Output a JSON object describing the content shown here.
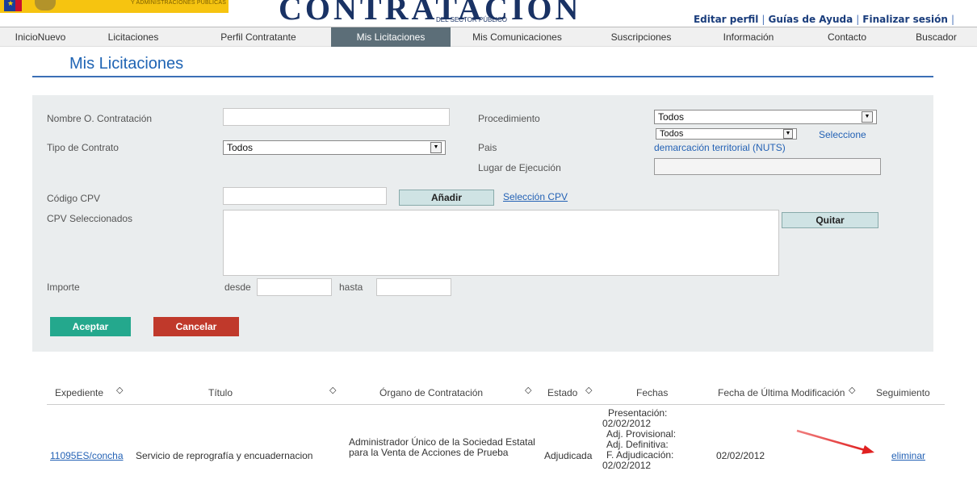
{
  "header": {
    "ministry_text": "Y ADMINISTRACIONES PÚBLICAS",
    "logo_text": "CONTRATACIÓN",
    "logo_subtext": "DEL SECTOR PÚBLICO",
    "user_links": [
      "Editar perfil",
      "Guías de Ayuda",
      "Finalizar sesión"
    ]
  },
  "nav": {
    "items": [
      "InicioNuevo",
      "Licitaciones",
      "Perfil Contratante",
      "Mis Licitaciones",
      "Mis Comunicaciones",
      "Suscripciones",
      "Información",
      "Contacto",
      "Buscador"
    ],
    "active": "Mis Licitaciones"
  },
  "page": {
    "title": "Mis Licitaciones"
  },
  "filters": {
    "nombre_label": "Nombre O. Contratación",
    "nombre_value": "",
    "procedimiento_label": "Procedimiento",
    "procedimiento_value": "Todos",
    "tipo_label": "Tipo de Contrato",
    "tipo_value": "Todos",
    "pais_label": "Pais",
    "pais_value": "Todos",
    "seleccione_link": "Seleccione",
    "nuts_link": "demarcación territorial (NUTS)",
    "lugar_label": "Lugar de Ejecución",
    "lugar_value": "",
    "cpv_label": "Código CPV",
    "cpv_value": "",
    "anadir_button": "Añadir",
    "seleccion_cpv_link": "Selección CPV",
    "cpv_sel_label": "CPV Seleccionados",
    "quitar_button": "Quitar",
    "importe_label": "Importe",
    "desde_label": "desde",
    "hasta_label": "hasta",
    "aceptar_button": "Aceptar",
    "cancelar_button": "Cancelar"
  },
  "table": {
    "headers": [
      "Expediente",
      "Título",
      "Órgano de Contratación",
      "Estado",
      "Fechas",
      "Fecha de Última Modificación",
      "Seguimiento"
    ],
    "rows": [
      {
        "expediente": "11095ES/concha",
        "titulo": "Servicio de reprografía y encuadernacion",
        "organo": "Administrador Único de la Sociedad Estatal para la Venta de Acciones de Prueba",
        "estado": "Adjudicada",
        "fechas": [
          "Presentación:",
          "02/02/2012",
          "Adj. Provisional:",
          "Adj. Definitiva:",
          "F. Adjudicación:",
          "02/02/2012"
        ],
        "ultima_mod": "02/02/2012",
        "seguimiento": "eliminar"
      }
    ]
  },
  "colors": {
    "accent": "#1f64b4",
    "nav_active": "#5c6e78",
    "accept": "#24a88d",
    "cancel": "#c0392b",
    "annotation_arrow": "#e02020"
  }
}
